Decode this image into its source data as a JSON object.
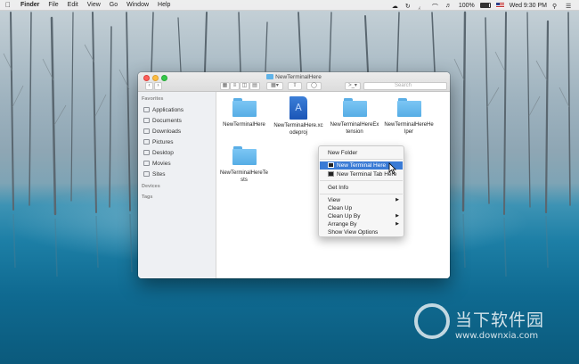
{
  "menubar": {
    "apple_icon": "apple-icon",
    "items": [
      "Finder",
      "File",
      "Edit",
      "View",
      "Go",
      "Window",
      "Help"
    ],
    "battery_label": "100%",
    "clock": "Wed 9:30 PM"
  },
  "window": {
    "title": "NewTerminalHere",
    "search_placeholder": "Search",
    "toolbar_action_label": ">_"
  },
  "sidebar": {
    "favorites_heading": "Favorites",
    "items": [
      "Applications",
      "Documents",
      "Downloads",
      "Pictures",
      "Desktop",
      "Movies",
      "Sites"
    ],
    "devices_heading": "Devices",
    "tags_heading": "Tags"
  },
  "files": [
    {
      "name": "NewTerminalHere",
      "kind": "folder"
    },
    {
      "name": "NewTerminalHere.xcodeproj",
      "kind": "xcodeproj"
    },
    {
      "name": "NewTerminalHereExtension",
      "kind": "folder"
    },
    {
      "name": "NewTerminalHereHelper",
      "kind": "folder"
    },
    {
      "name": "NewTerminalHereTests",
      "kind": "folder"
    }
  ],
  "context_menu": {
    "items": [
      "New Folder",
      "New Terminal Here",
      "New Terminal Tab Here",
      "Get Info",
      "View",
      "Clean Up",
      "Clean Up By",
      "Arrange By",
      "Show View Options"
    ],
    "highlighted": "New Terminal Here"
  },
  "watermark": {
    "text": "当下软件园",
    "url": "www.downxia.com"
  },
  "colors": {
    "highlight": "#3a7bd5",
    "folder": "#6bbcf0",
    "close": "#fc605b",
    "minimize": "#fdbc40",
    "maximize": "#34c84a"
  }
}
